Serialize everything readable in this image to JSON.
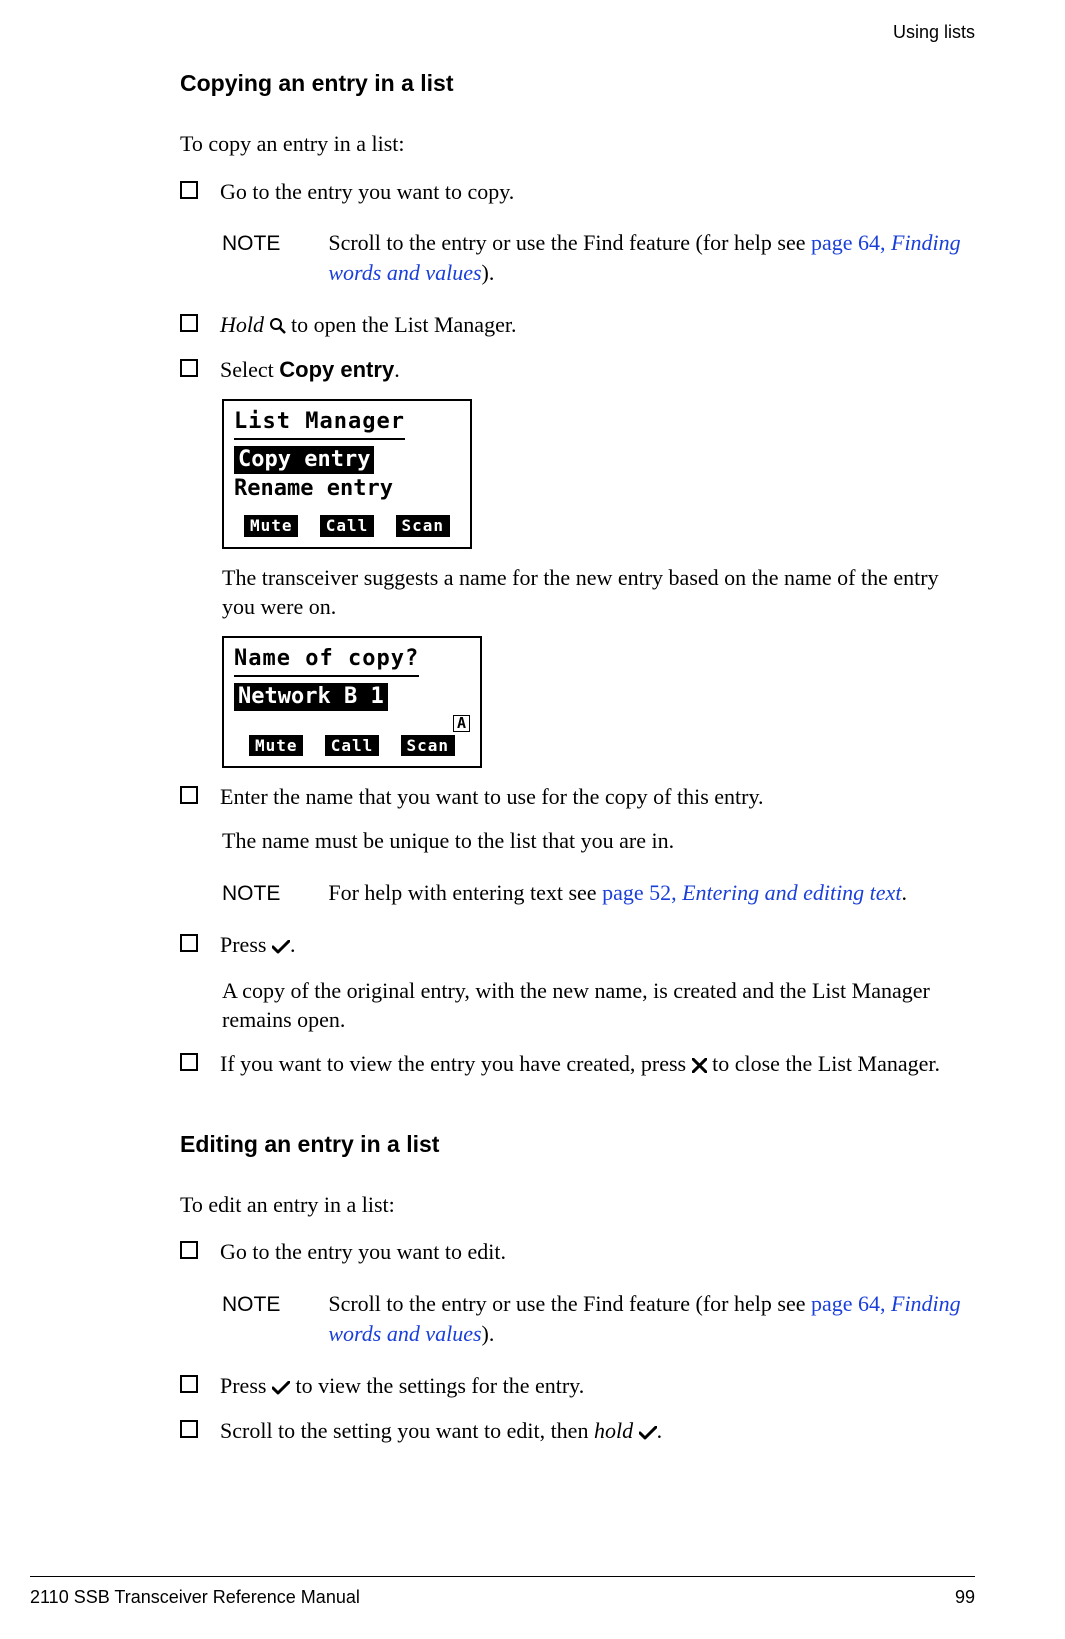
{
  "header": {
    "right": "Using lists"
  },
  "footer": {
    "left": "2110 SSB Transceiver Reference Manual",
    "right": "99"
  },
  "section1": {
    "title": "Copying an entry in a list",
    "intro": "To copy an entry in a list:",
    "step1": "Go to the entry you want to copy.",
    "note1": {
      "label": "NOTE",
      "pre": "Scroll to the entry or use the Find feature (for help see ",
      "link1": "page 64",
      "comma": ", ",
      "link2": "Finding words and values",
      "post": ")."
    },
    "step2_pre": "Hold",
    "step2_post": " to open the List Manager.",
    "step3_pre": "Select ",
    "step3_bold": "Copy entry",
    "step3_post": ".",
    "lcd1": {
      "title": "List Manager",
      "row_hl": "Copy entry",
      "row2": "Rename entry",
      "soft1": "Mute",
      "soft2": "Call",
      "soft3": "Scan"
    },
    "para_after_lcd1": "The transceiver suggests a name for the new entry based on the name of the entry you were on.",
    "lcd2": {
      "title": "Name of copy?",
      "row_hl": "Network B 1",
      "indicator": "A",
      "soft1": "Mute",
      "soft2": "Call",
      "soft3": "Scan"
    },
    "step4": "Enter the name that you want to use for the copy of this entry.",
    "step4_sub": "The name must be unique to the list that you are in.",
    "note2": {
      "label": "NOTE",
      "pre": "For help with entering text see ",
      "link1": "page 52",
      "comma": ", ",
      "link2": "Entering and editing text",
      "post": "."
    },
    "step5_pre": "Press ",
    "step5_post": ".",
    "step5_sub": "A copy of the original entry, with the new name, is created and the List Manager remains open.",
    "step6_pre": "If you want to view the entry you have created, press ",
    "step6_post": " to close the List Manager."
  },
  "section2": {
    "title": "Editing an entry in a list",
    "intro": "To edit an entry in a list:",
    "step1": "Go to the entry you want to edit.",
    "note1": {
      "label": "NOTE",
      "pre": "Scroll to the entry or use the Find feature (for help see ",
      "link1": "page 64",
      "comma": ", ",
      "link2": "Finding words and values",
      "post": ")."
    },
    "step2_pre": "Press ",
    "step2_post": " to view the settings for the entry.",
    "step3_pre": "Scroll to the setting you want to edit, then ",
    "step3_hold": "hold",
    "step3_post": "."
  }
}
